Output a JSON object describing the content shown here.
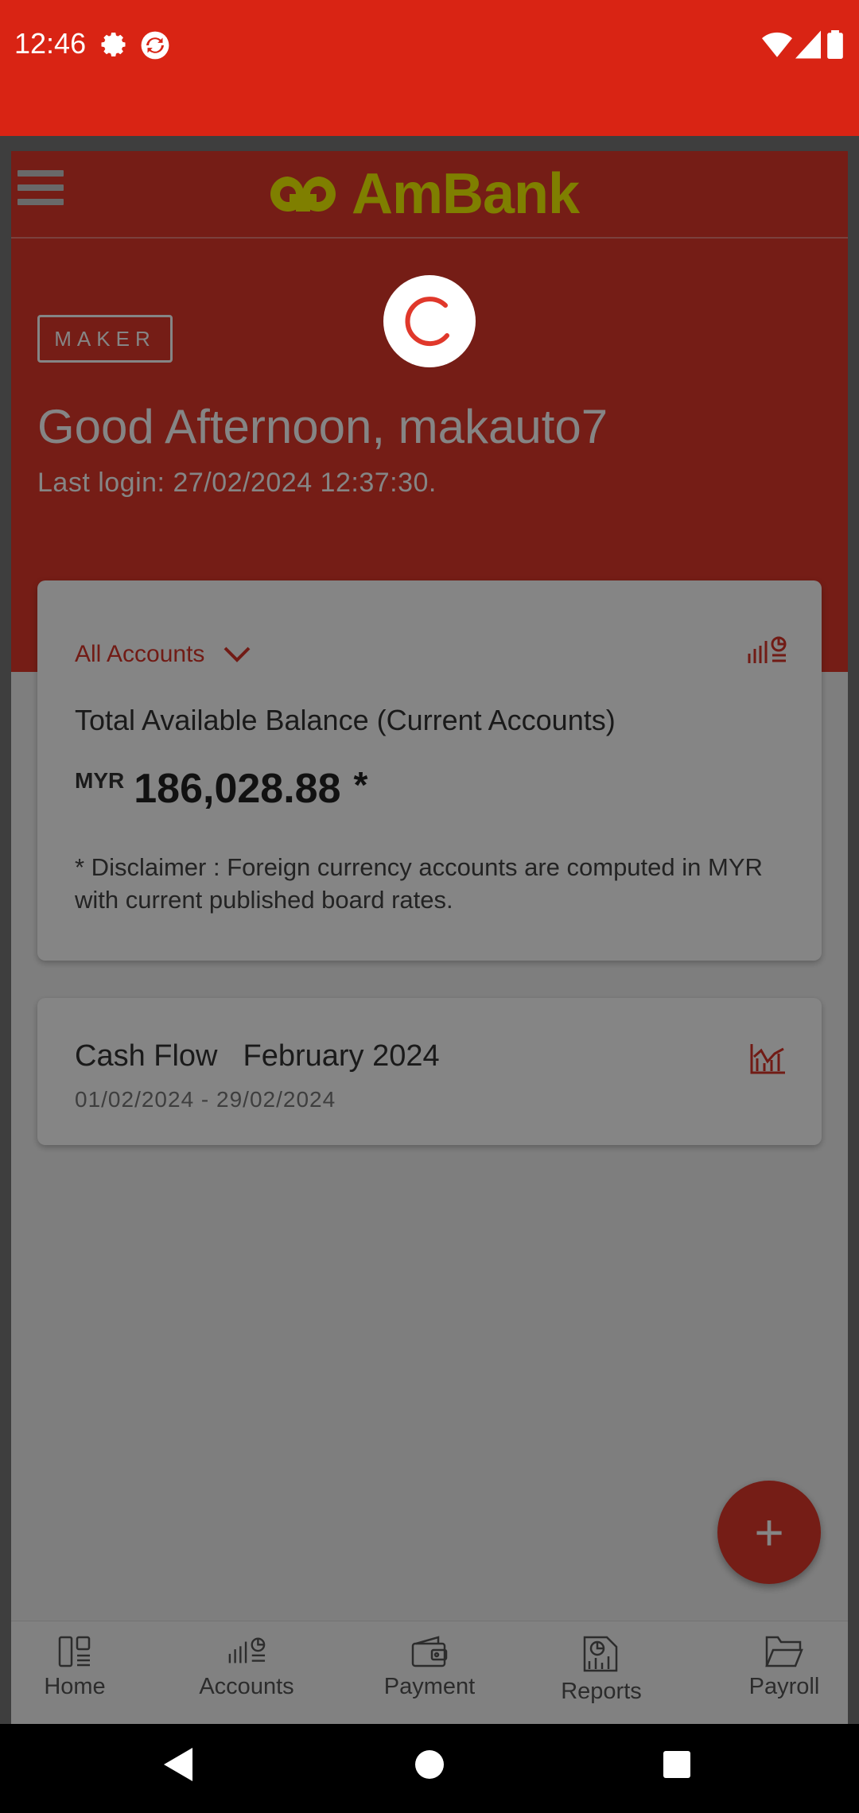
{
  "status_bar": {
    "time": "12:46",
    "icons": [
      "gear-icon",
      "sync-icon",
      "wifi-icon",
      "signal-icon",
      "battery-icon"
    ],
    "background": "#d92414"
  },
  "header": {
    "logo_text": "AmBank",
    "logo_color": "#f4f400"
  },
  "hero": {
    "role_badge": "MAKER",
    "greeting": "Good Afternoon, makauto7",
    "last_login": "Last login: 27/02/2024 12:37:30.",
    "background": "#e0382b"
  },
  "balance_card": {
    "dropdown_label": "All Accounts",
    "title": "Total Available Balance (Current Accounts)",
    "currency": "MYR",
    "amount": "186,028.88",
    "star": "*",
    "disclaimer": "* Disclaimer : Foreign currency accounts are computed in MYR with current published board rates."
  },
  "cashflow_card": {
    "title": "Cash Flow",
    "month": "February 2024",
    "range": "01/02/2024 - 29/02/2024"
  },
  "fab": {
    "label": "+"
  },
  "bottom_nav": {
    "items": [
      {
        "label": "Home",
        "icon": "home-icon"
      },
      {
        "label": "Accounts",
        "icon": "accounts-icon"
      },
      {
        "label": "Payment",
        "icon": "wallet-icon"
      },
      {
        "label": "Reports",
        "icon": "reports-icon"
      },
      {
        "label": "Payroll",
        "icon": "folder-icon"
      }
    ]
  },
  "overlay": {
    "loading": true
  },
  "accent_color": "#d9342a"
}
